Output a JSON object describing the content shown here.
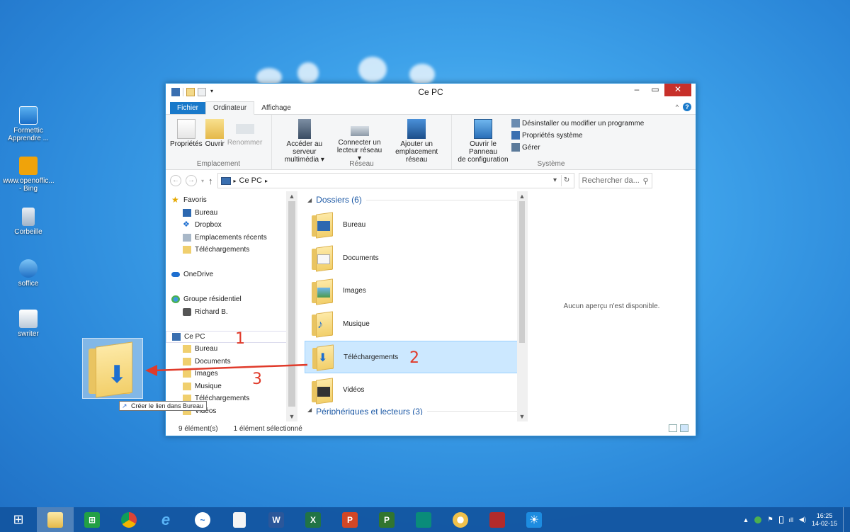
{
  "desktop": {
    "icons": [
      {
        "label": "Formettic Apprendre ..."
      },
      {
        "label": "www.openoffic... - Bing"
      },
      {
        "label": "Corbeille"
      },
      {
        "label": "soffice"
      },
      {
        "label": "swriter"
      }
    ]
  },
  "window": {
    "title": "Ce PC",
    "tabs": {
      "file": "Fichier",
      "computer": "Ordinateur",
      "view": "Affichage"
    },
    "ribbon": {
      "location_group": "Emplacement",
      "network_group": "Réseau",
      "system_group": "Système",
      "properties": "Propriétés",
      "open": "Ouvrir",
      "rename": "Renommer",
      "media_server_line1": "Accéder au serveur",
      "media_server_line2": "multimédia ▾",
      "map_drive_line1": "Connecter un",
      "map_drive_line2": "lecteur réseau ▾",
      "add_location_line1": "Ajouter un",
      "add_location_line2": "emplacement réseau",
      "control_panel_line1": "Ouvrir le Panneau",
      "control_panel_line2": "de configuration",
      "uninstall": "Désinstaller ou modifier un programme",
      "system_props": "Propriétés système",
      "manage": "Gérer"
    },
    "address": {
      "path": "Ce PC",
      "search_placeholder": "Rechercher da..."
    },
    "nav": {
      "favorites": "Favoris",
      "fav_items": [
        "Bureau",
        "Dropbox",
        "Emplacements récents",
        "Téléchargements"
      ],
      "onedrive": "OneDrive",
      "homegroup": "Groupe résidentiel",
      "homegroup_user": "Richard B.",
      "this_pc": "Ce PC",
      "pc_items": [
        "Bureau",
        "Documents",
        "Images",
        "Musique",
        "Téléchargements",
        "Vidéos"
      ]
    },
    "folders_header": "Dossiers (6)",
    "folders": [
      "Bureau",
      "Documents",
      "Images",
      "Musique",
      "Téléchargements",
      "Vidéos"
    ],
    "devices_header": "Périphériques et lecteurs (3)",
    "preview_text": "Aucun aperçu n'est disponible.",
    "status": {
      "count": "9 élément(s)",
      "selected": "1 élément sélectionné"
    }
  },
  "drag": {
    "tooltip": "Créer le lien dans Bureau"
  },
  "annotations": [
    "1",
    "2",
    "3"
  ],
  "taskbar": {
    "time": "16:25",
    "date": "14-02-15"
  },
  "colors": {
    "accent": "#1979ca",
    "annotation": "#e03a2a",
    "close": "#c7302a"
  }
}
